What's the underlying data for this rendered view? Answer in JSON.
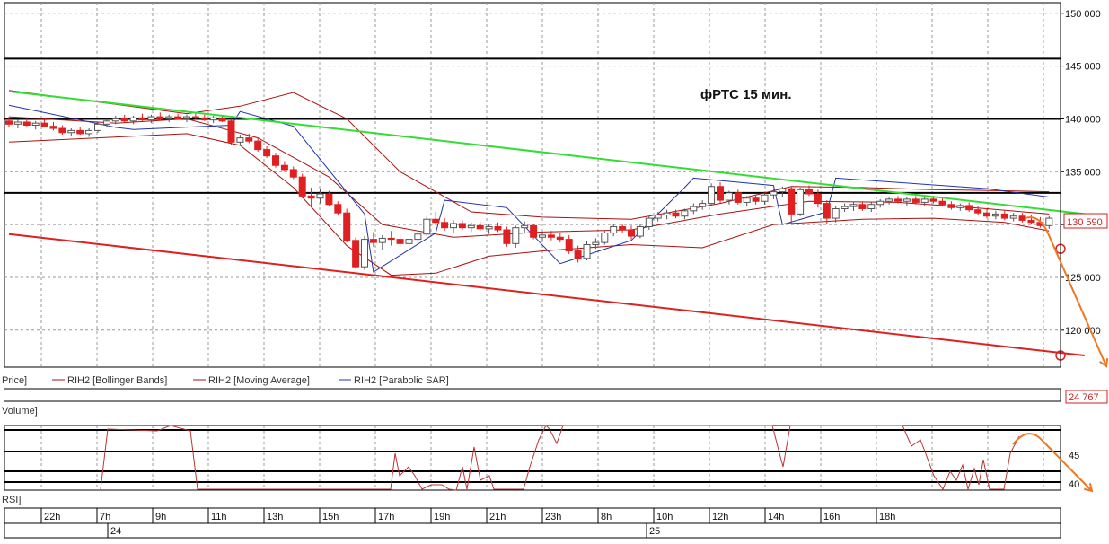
{
  "annotation": "фРТС  15 мин.",
  "legend": {
    "price": "Price]",
    "bollinger": "RIH2 [Bollinger Bands]",
    "ma": "RIH2 [Moving Average]",
    "sar": "RIH2 [Parabolic SAR]",
    "volume": "Volume]",
    "rsi": "RSI]"
  },
  "price_axis": [
    "150 000",
    "145 000",
    "140 000",
    "135 000",
    "130 000",
    "125 000",
    "120 000"
  ],
  "current_price_label": "130 590",
  "volume_value_label": "24 767",
  "rsi_axis": [
    "45",
    "40"
  ],
  "time_labels": [
    "22h",
    "7h",
    "9h",
    "11h",
    "13h",
    "15h",
    "17h",
    "19h",
    "21h",
    "23h",
    "8h",
    "10h",
    "12h",
    "14h",
    "16h",
    "18h"
  ],
  "date_labels": [
    "24",
    "25"
  ],
  "colors": {
    "up": "#ffffff",
    "down": "#e02020",
    "green_line": "#33dd33",
    "red_line": "#dd2020",
    "sar": "#2233aa",
    "bb": "#aa1111",
    "forecast": "#ee7722"
  },
  "chart_data": {
    "type": "candlestick",
    "title": "фРТС  15 мин.",
    "ylim": [
      116500,
      151000
    ],
    "levels": [
      145700,
      140000,
      133000
    ],
    "candles": [
      [
        139800,
        140200,
        139200,
        139500
      ],
      [
        139500,
        139900,
        139100,
        139700
      ],
      [
        139700,
        140100,
        139300,
        139400
      ],
      [
        139400,
        139800,
        139000,
        139600
      ],
      [
        139600,
        139900,
        139200,
        139300
      ],
      [
        139300,
        139700,
        138900,
        139100
      ],
      [
        139100,
        139400,
        138500,
        138700
      ],
      [
        138700,
        139100,
        138400,
        138900
      ],
      [
        138900,
        139200,
        138500,
        138600
      ],
      [
        138600,
        139100,
        138300,
        138900
      ],
      [
        138900,
        139700,
        138700,
        139500
      ],
      [
        139500,
        140000,
        139200,
        139800
      ],
      [
        139800,
        140300,
        139500,
        140000
      ],
      [
        140000,
        140400,
        139700,
        139800
      ],
      [
        139800,
        140300,
        139500,
        140100
      ],
      [
        140100,
        140500,
        139800,
        139900
      ],
      [
        139900,
        140400,
        139600,
        140200
      ],
      [
        140200,
        140600,
        139900,
        140000
      ],
      [
        140000,
        140400,
        139700,
        140200
      ],
      [
        140200,
        140500,
        139900,
        140000
      ],
      [
        140000,
        140400,
        139700,
        140200
      ],
      [
        140200,
        140500,
        139900,
        140100
      ],
      [
        140100,
        140400,
        139800,
        139900
      ],
      [
        139900,
        140300,
        139600,
        140100
      ],
      [
        140100,
        140300,
        139700,
        139800
      ],
      [
        139800,
        140000,
        137500,
        137800
      ],
      [
        137800,
        138500,
        137500,
        138200
      ],
      [
        138200,
        138600,
        137700,
        137900
      ],
      [
        137900,
        138200,
        136900,
        137100
      ],
      [
        137100,
        137400,
        136300,
        136500
      ],
      [
        136500,
        136800,
        135400,
        135600
      ],
      [
        135600,
        136000,
        135000,
        135200
      ],
      [
        135200,
        135500,
        134300,
        134500
      ],
      [
        134500,
        134800,
        132500,
        132700
      ],
      [
        132700,
        133500,
        131600,
        132500
      ],
      [
        132500,
        133400,
        132000,
        132900
      ],
      [
        132900,
        133200,
        131700,
        131900
      ],
      [
        131900,
        132200,
        130900,
        131100
      ],
      [
        131100,
        131500,
        128300,
        128500
      ],
      [
        128500,
        128800,
        125800,
        126000
      ],
      [
        126000,
        128900,
        125700,
        128600
      ],
      [
        128600,
        129300,
        127900,
        128300
      ],
      [
        128300,
        129000,
        127600,
        128700
      ],
      [
        128700,
        129400,
        128000,
        128600
      ],
      [
        128600,
        129000,
        127900,
        128200
      ],
      [
        128200,
        128900,
        127700,
        128600
      ],
      [
        128600,
        129300,
        128100,
        129100
      ],
      [
        129100,
        130800,
        128900,
        130500
      ],
      [
        130500,
        131200,
        129900,
        130200
      ],
      [
        130200,
        130600,
        129400,
        129700
      ],
      [
        129700,
        130400,
        129200,
        130100
      ],
      [
        130100,
        130400,
        129500,
        129700
      ],
      [
        129700,
        130200,
        129300,
        129900
      ],
      [
        129900,
        130300,
        129400,
        129600
      ],
      [
        129600,
        130000,
        129100,
        129800
      ],
      [
        129800,
        130200,
        129300,
        129500
      ],
      [
        129500,
        129800,
        127900,
        128200
      ],
      [
        128200,
        129900,
        127800,
        129700
      ],
      [
        129700,
        130300,
        129200,
        129900
      ],
      [
        129900,
        130100,
        128600,
        128800
      ],
      [
        128800,
        129300,
        128400,
        129000
      ],
      [
        129000,
        129400,
        128500,
        128800
      ],
      [
        128800,
        129200,
        128300,
        128600
      ],
      [
        128600,
        129000,
        127200,
        127500
      ],
      [
        127500,
        128000,
        126400,
        126800
      ],
      [
        126800,
        128400,
        126600,
        128100
      ],
      [
        128100,
        128700,
        127700,
        128300
      ],
      [
        128300,
        129400,
        128100,
        129200
      ],
      [
        129200,
        130100,
        128900,
        129800
      ],
      [
        129800,
        130100,
        129200,
        129500
      ],
      [
        129500,
        129900,
        128600,
        128900
      ],
      [
        128900,
        130000,
        128700,
        129800
      ],
      [
        129800,
        130800,
        129500,
        130600
      ],
      [
        130600,
        131200,
        130300,
        130900
      ],
      [
        130900,
        131400,
        130500,
        131100
      ],
      [
        131100,
        131400,
        130600,
        130800
      ],
      [
        130800,
        131500,
        130500,
        131300
      ],
      [
        131300,
        132000,
        131000,
        131700
      ],
      [
        131700,
        132300,
        131400,
        132000
      ],
      [
        132000,
        133900,
        131800,
        133600
      ],
      [
        133600,
        134000,
        132000,
        132300
      ],
      [
        132300,
        133200,
        131900,
        133000
      ],
      [
        133000,
        133300,
        131900,
        132100
      ],
      [
        132100,
        132700,
        131700,
        132500
      ],
      [
        132500,
        132800,
        131900,
        132200
      ],
      [
        132200,
        133000,
        131900,
        132800
      ],
      [
        132800,
        133400,
        132400,
        133100
      ],
      [
        133100,
        133600,
        132600,
        133400
      ],
      [
        133400,
        133600,
        130000,
        131000
      ],
      [
        131000,
        133500,
        130800,
        133300
      ],
      [
        133300,
        133700,
        132700,
        132900
      ],
      [
        132900,
        133300,
        131600,
        132000
      ],
      [
        132000,
        132300,
        130000,
        130600
      ],
      [
        130600,
        131800,
        130200,
        131500
      ],
      [
        131500,
        132000,
        131200,
        131700
      ],
      [
        131700,
        132100,
        131300,
        131900
      ],
      [
        131900,
        132200,
        131300,
        131500
      ],
      [
        131500,
        132100,
        131200,
        131900
      ],
      [
        131900,
        132400,
        131600,
        132200
      ],
      [
        132200,
        132600,
        131900,
        132400
      ],
      [
        132400,
        132700,
        132000,
        132200
      ],
      [
        132200,
        132600,
        131800,
        132400
      ],
      [
        132400,
        132700,
        131900,
        132100
      ],
      [
        132100,
        132600,
        131800,
        132400
      ],
      [
        132400,
        132700,
        132000,
        132200
      ],
      [
        132200,
        132500,
        131700,
        131900
      ],
      [
        131900,
        132200,
        131400,
        131600
      ],
      [
        131600,
        132000,
        131300,
        131800
      ],
      [
        131800,
        132100,
        131200,
        131400
      ],
      [
        131400,
        131800,
        130900,
        131100
      ],
      [
        131100,
        131500,
        130600,
        130800
      ],
      [
        130800,
        131300,
        130500,
        131000
      ],
      [
        131000,
        131300,
        130400,
        130600
      ],
      [
        130600,
        131100,
        130300,
        130800
      ],
      [
        130800,
        131100,
        130200,
        130400
      ],
      [
        130400,
        130900,
        130000,
        130200
      ],
      [
        130200,
        130700,
        129700,
        129900
      ],
      [
        129900,
        130800,
        129600,
        130600
      ]
    ],
    "indicators": {
      "bollinger_upper": [
        [
          0,
          142700
        ],
        [
          20,
          140500
        ],
        [
          26,
          141200
        ],
        [
          32,
          142500
        ],
        [
          38,
          140000
        ],
        [
          44,
          135000
        ],
        [
          52,
          131200
        ],
        [
          60,
          130700
        ],
        [
          70,
          130500
        ],
        [
          80,
          132000
        ],
        [
          88,
          133600
        ],
        [
          96,
          133500
        ],
        [
          104,
          133300
        ],
        [
          112,
          133200
        ],
        [
          117,
          133100
        ]
      ],
      "bollinger_lower": [
        [
          0,
          137800
        ],
        [
          20,
          138600
        ],
        [
          26,
          137500
        ],
        [
          32,
          133500
        ],
        [
          38,
          128000
        ],
        [
          43,
          125200
        ],
        [
          48,
          125400
        ],
        [
          54,
          127000
        ],
        [
          60,
          127500
        ],
        [
          70,
          128100
        ],
        [
          78,
          127800
        ],
        [
          86,
          130000
        ],
        [
          96,
          130500
        ],
        [
          104,
          130600
        ],
        [
          112,
          130200
        ],
        [
          117,
          129400
        ]
      ],
      "moving_average": [
        [
          0,
          140200
        ],
        [
          12,
          139600
        ],
        [
          20,
          140000
        ],
        [
          28,
          138200
        ],
        [
          36,
          134500
        ],
        [
          42,
          130000
        ],
        [
          50,
          128800
        ],
        [
          60,
          129300
        ],
        [
          70,
          129500
        ],
        [
          80,
          131000
        ],
        [
          90,
          132200
        ],
        [
          100,
          132100
        ],
        [
          110,
          131500
        ],
        [
          117,
          131000
        ]
      ],
      "parabolic_sar": [
        [
          0,
          141300
        ],
        [
          12,
          139200
        ],
        [
          14,
          139000
        ],
        [
          25,
          139400
        ],
        [
          26,
          140700
        ],
        [
          32,
          139300
        ],
        [
          40,
          131000
        ],
        [
          41,
          125500
        ],
        [
          48,
          129200
        ],
        [
          49,
          132300
        ],
        [
          56,
          131600
        ],
        [
          62,
          126300
        ],
        [
          70,
          128500
        ],
        [
          76,
          133500
        ],
        [
          77,
          134400
        ],
        [
          86,
          133700
        ],
        [
          87,
          130000
        ],
        [
          92,
          131200
        ],
        [
          93,
          134400
        ],
        [
          110,
          133400
        ],
        [
          117,
          132600
        ]
      ]
    },
    "trend_lines": [
      {
        "color": "green",
        "points": [
          [
            0,
            142600
          ],
          [
            121,
            131000
          ]
        ]
      },
      {
        "color": "red",
        "points": [
          [
            0,
            129100
          ],
          [
            121,
            117600
          ]
        ]
      }
    ]
  }
}
